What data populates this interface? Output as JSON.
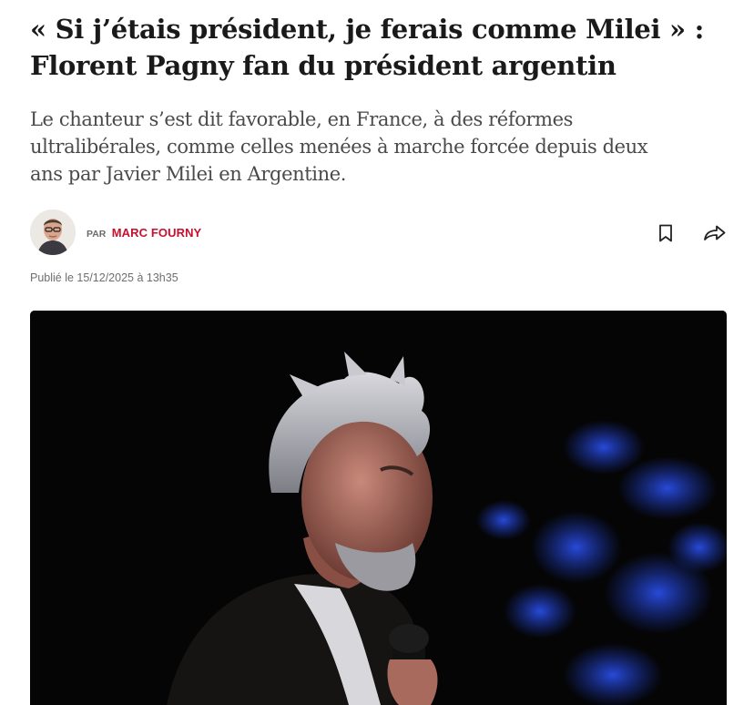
{
  "article": {
    "headline_line1": "« Si j’étais président, je ferais comme Milei » :",
    "headline_line2": "Florent Pagny fan du président argentin",
    "standfirst_line1": "Le chanteur s’est dit favorable, en France, à des réformes",
    "standfirst_line2": "ultralibérales, comme celles menées à marche forcée depuis deux",
    "standfirst_line3": "ans par Javier Milei en Argentine."
  },
  "byline": {
    "prefix": "PAR",
    "author": "MARC FOURNY"
  },
  "published": "Publié le 15/12/2025 à 13h35",
  "icons": {
    "bookmark": "bookmark-icon",
    "share": "share-icon"
  },
  "colors": {
    "author_accent": "#c8102e",
    "headline": "#1a1a1a",
    "standfirst": "#4a4a4a",
    "meta": "#6e6e6e",
    "hero_background": "#050505",
    "hero_bokeh": "#1f3fd0"
  }
}
